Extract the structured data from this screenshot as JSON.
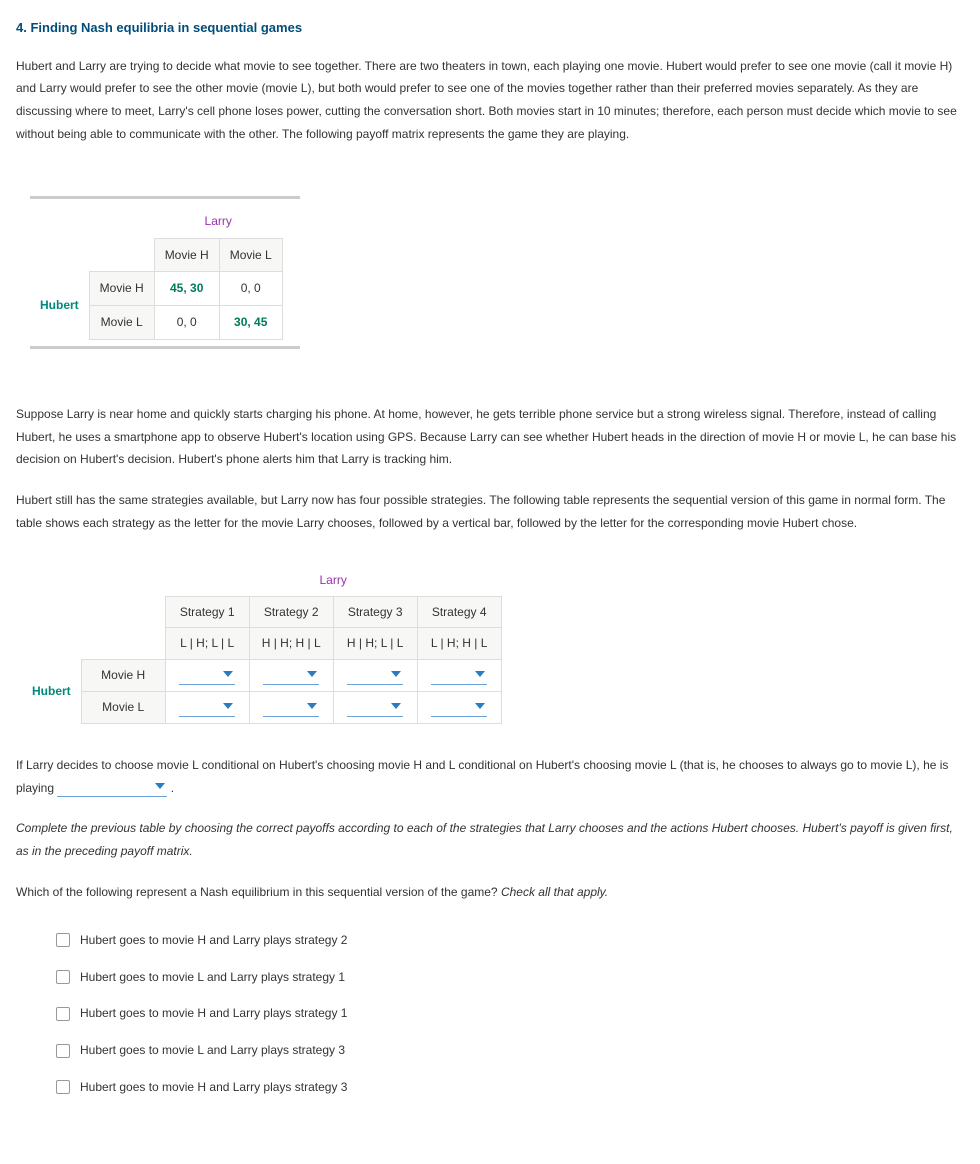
{
  "title": "4. Finding Nash equilibria in sequential games",
  "para1": "Hubert and Larry are trying to decide what movie to see together. There are two theaters in town, each playing one movie. Hubert would prefer to see one movie (call it movie H) and Larry would prefer to see the other movie (movie L), but both would prefer to see one of the movies together rather than their preferred movies separately. As they are discussing where to meet, Larry's cell phone loses power, cutting the conversation short. Both movies start in 10 minutes; therefore, each person must decide which movie to see without being able to communicate with the other. The following payoff matrix represents the game they are playing.",
  "matrix1": {
    "colPlayer": "Larry",
    "rowPlayer": "Hubert",
    "cols": [
      "Movie H",
      "Movie L"
    ],
    "rows": [
      "Movie H",
      "Movie L"
    ],
    "cells": [
      [
        "45, 30",
        "0, 0"
      ],
      [
        "0, 0",
        "30, 45"
      ]
    ]
  },
  "para2": "Suppose Larry is near home and quickly starts charging his phone. At home, however, he gets terrible phone service but a strong wireless signal. Therefore, instead of calling Hubert, he uses a smartphone app to observe Hubert's location using GPS. Because Larry can see whether Hubert heads in the direction of movie H or movie L, he can base his decision on Hubert's decision. Hubert's phone alerts him that Larry is tracking him.",
  "para3": "Hubert still has the same strategies available, but Larry now has four possible strategies. The following table represents the sequential version of this game in normal form. The table shows each strategy as the letter for the movie Larry chooses, followed by a vertical bar, followed by the letter for the corresponding movie Hubert chose.",
  "matrix2": {
    "colPlayer": "Larry",
    "rowPlayer": "Hubert",
    "stratHeaders": [
      "Strategy 1",
      "Strategy 2",
      "Strategy 3",
      "Strategy 4"
    ],
    "stratCodes": [
      "L | H; L | L",
      "H | H; H | L",
      "H | H; L | L",
      "L | H; H | L"
    ],
    "rows": [
      "Movie H",
      "Movie L"
    ]
  },
  "para4a": "If Larry decides to choose movie L conditional on Hubert's choosing movie H and L conditional on Hubert's choosing movie L (that is, he chooses to always go to movie L), he is playing ",
  "para4b": " .",
  "para5": "Complete the previous table by choosing the correct payoffs according to each of the strategies that Larry chooses and the actions Hubert chooses. Hubert's payoff is given first, as in the preceding payoff matrix.",
  "para6a": "Which of the following represent a Nash equilibrium in this sequential version of the game? ",
  "para6b": "Check all that apply.",
  "checks": [
    "Hubert goes to movie H and Larry plays strategy 2",
    "Hubert goes to movie L and Larry plays strategy 1",
    "Hubert goes to movie H and Larry plays strategy 1",
    "Hubert goes to movie L and Larry plays strategy 3",
    "Hubert goes to movie H and Larry plays strategy 3"
  ]
}
